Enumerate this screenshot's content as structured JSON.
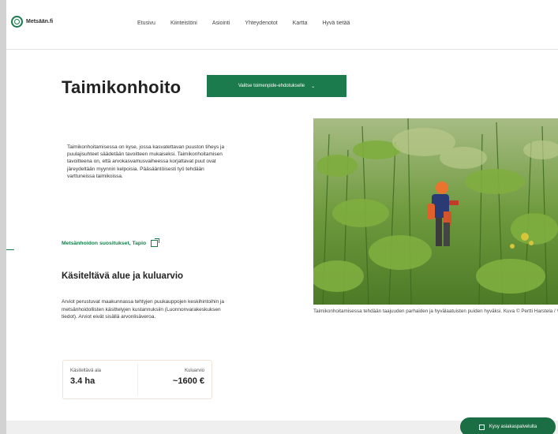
{
  "header": {
    "logo_text": "Metsään.fi",
    "nav": [
      "Etusivu",
      "Kiinteistöni",
      "Asiointi",
      "Yhteydenotot",
      "Kartta",
      "Hyvä tietää"
    ]
  },
  "main": {
    "title": "Taimikonhoito",
    "select_label": "Valitse toimenpide-ehdotukselle",
    "select_chevron": "⌄",
    "intro": "Taimikonhoitamisessa on kyse, jossa kasvatettavan puuston tiheys ja puulajisuhteet säädetään tavoitteen mukaiseksi. Taimikonhoitamisen tavoitteena on, että arvokasvamusvaiheessa korjattavat puut ovat järeydeltään myynnin kelpoisia. Pääsääntöisesti työ tehdään varttuneissa taimikoissa.",
    "link_text": "Metsänhoidon suositukset, Tapio",
    "section_title": "Käsiteltävä alue ja kuluarvio",
    "section_body": "Arviot perustuvat maakunnassa tehtyjen puukauppojen keskihintoihin ja metsänhoidollisten käsittelyjen kustannuksiin (Luonnonvarakeskuksen tiedot). Arviot eivät sisällä arvonlisäveroa.",
    "stats": {
      "area_label": "Käsiteltävä ala",
      "area_value": "3.4 ha",
      "cost_label": "Kuluarvio",
      "cost_value": "~1600 €"
    },
    "caption": "Taimikonhoitamisessa tehdään taajuuden parhaiden ja hyvälaatuisten puiden hyväksi. Kuva © Pertti Harstela / Vastavalo"
  },
  "fab": {
    "label": "Kysy asiakaspalvelulta"
  },
  "colors": {
    "brand_green": "#1b7b4c",
    "text_dark": "#222222"
  }
}
